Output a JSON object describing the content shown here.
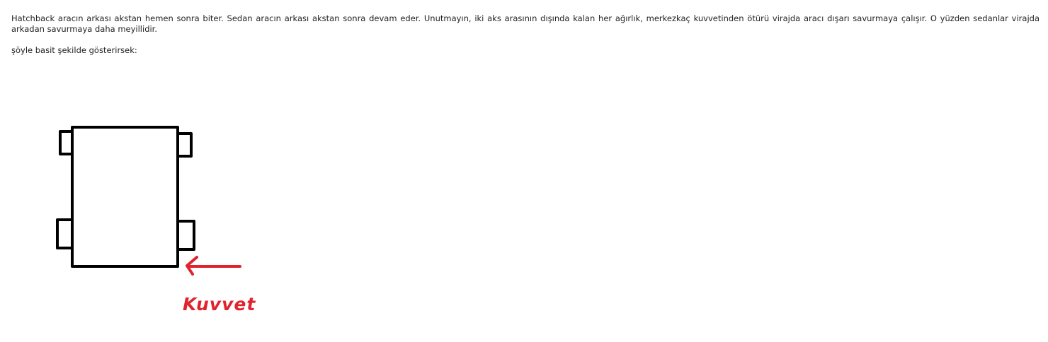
{
  "post": {
    "paragraph1": "Hatchback aracın arkası akstan hemen sonra biter. Sedan aracın arkası akstan sonra devam eder. Unutmayın, iki aks arasının dışında kalan her ağırlık, merkezkaç kuvvetinden ötürü virajda aracı dışarı savurmaya çalışır. O yüzden sedanlar virajda arkadan savurmaya daha meyillidir.",
    "paragraph2": "şöyle basit şekilde gösterirsek:"
  },
  "sketch": {
    "force_label": "Kuvvet",
    "stroke_color": "#000000",
    "arrow_color": "#e0242e"
  }
}
